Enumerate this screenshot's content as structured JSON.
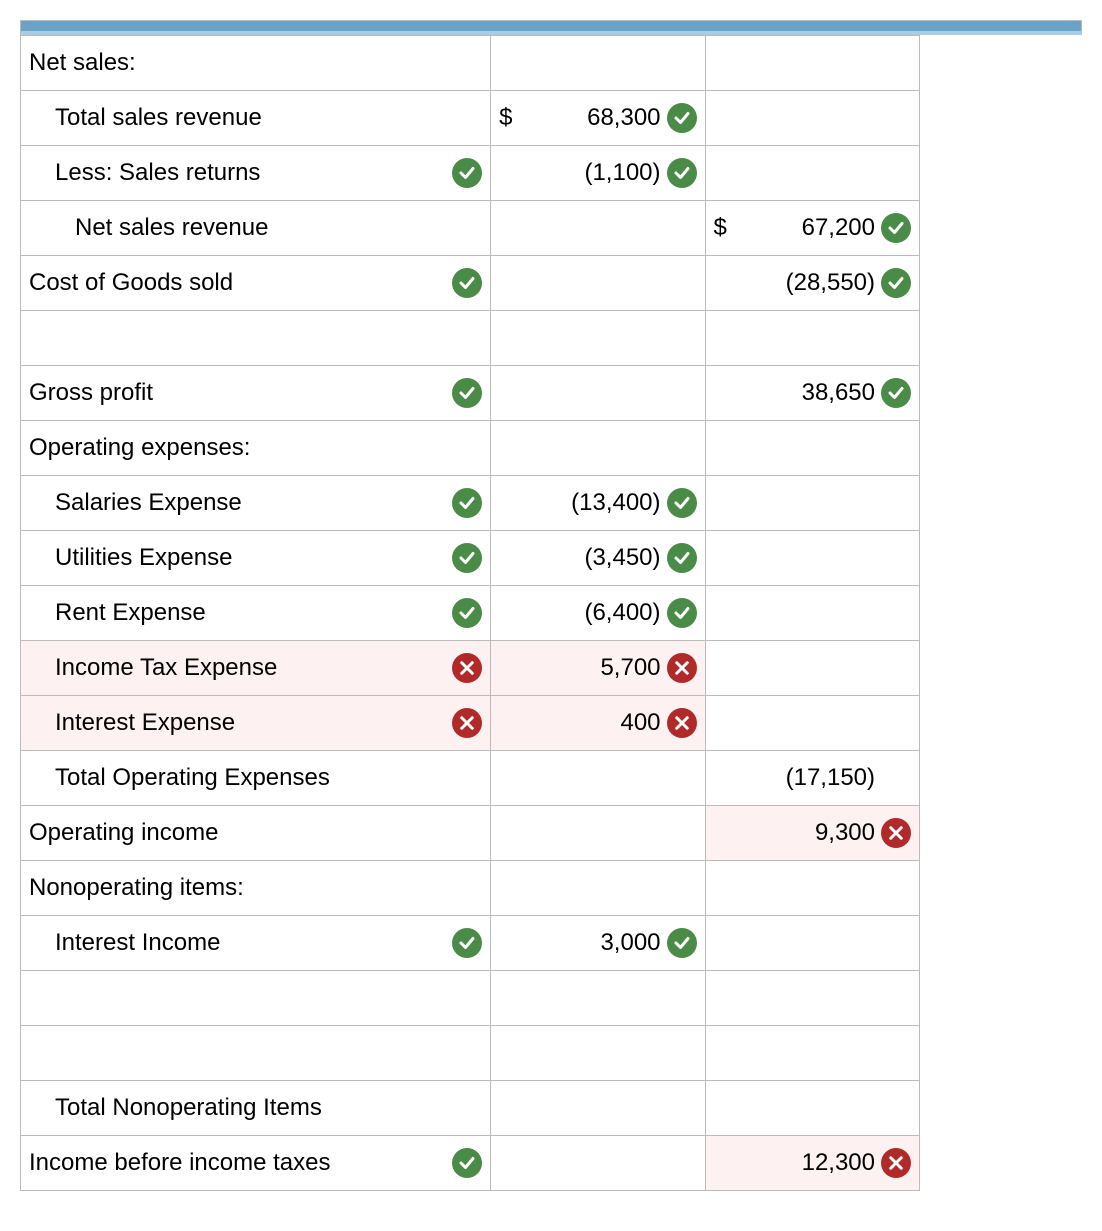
{
  "rows": [
    {
      "label": "Net sales:",
      "indent": 0
    },
    {
      "label": "Total sales revenue",
      "indent": 1,
      "col2": {
        "dollar": "$",
        "value": "68,300",
        "mark": "correct"
      }
    },
    {
      "label": "Less: Sales returns",
      "indent": 1,
      "labelMark": "correct",
      "col2": {
        "value": "(1,100)",
        "mark": "correct"
      }
    },
    {
      "label": "Net sales revenue",
      "indent": 2,
      "col3": {
        "dollar": "$",
        "value": "67,200",
        "mark": "correct"
      }
    },
    {
      "label": "Cost of Goods sold",
      "indent": 0,
      "labelMark": "correct",
      "col3": {
        "value": "(28,550)",
        "mark": "correct"
      }
    },
    {
      "blank": true
    },
    {
      "label": "Gross profit",
      "indent": 0,
      "labelMark": "correct",
      "col3": {
        "value": "38,650",
        "mark": "correct"
      }
    },
    {
      "label": "Operating expenses:",
      "indent": 0
    },
    {
      "label": "Salaries Expense",
      "indent": 1,
      "labelMark": "correct",
      "col2": {
        "value": "(13,400)",
        "mark": "correct"
      }
    },
    {
      "label": "Utilities Expense",
      "indent": 1,
      "labelMark": "correct",
      "col2": {
        "value": "(3,450)",
        "mark": "correct"
      }
    },
    {
      "label": "Rent Expense",
      "indent": 1,
      "labelMark": "correct",
      "col2": {
        "value": "(6,400)",
        "mark": "correct"
      }
    },
    {
      "label": "Income Tax Expense",
      "indent": 1,
      "labelMark": "wrong",
      "rowWrong": true,
      "col2": {
        "value": "5,700",
        "mark": "wrong",
        "wrongCell": true
      }
    },
    {
      "label": "Interest Expense",
      "indent": 1,
      "labelMark": "wrong",
      "rowWrong": true,
      "col2": {
        "value": "400",
        "mark": "wrong",
        "wrongCell": true
      }
    },
    {
      "label": "Total Operating Expenses",
      "indent": 1,
      "col3": {
        "value": "(17,150)"
      }
    },
    {
      "label": "Operating income",
      "indent": 0,
      "col3": {
        "value": "9,300",
        "mark": "wrong",
        "wrongCell3": true
      }
    },
    {
      "label": "Nonoperating items:",
      "indent": 0
    },
    {
      "label": "Interest Income",
      "indent": 1,
      "labelMark": "correct",
      "col2": {
        "value": "3,000",
        "mark": "correct"
      }
    },
    {
      "blank": true
    },
    {
      "blank": true
    },
    {
      "label": "Total Nonoperating Items",
      "indent": 1
    },
    {
      "label": "Income before income taxes",
      "indent": 0,
      "labelMark": "correct",
      "col3": {
        "value": "12,300",
        "mark": "wrong",
        "wrongCell3": true
      }
    }
  ]
}
